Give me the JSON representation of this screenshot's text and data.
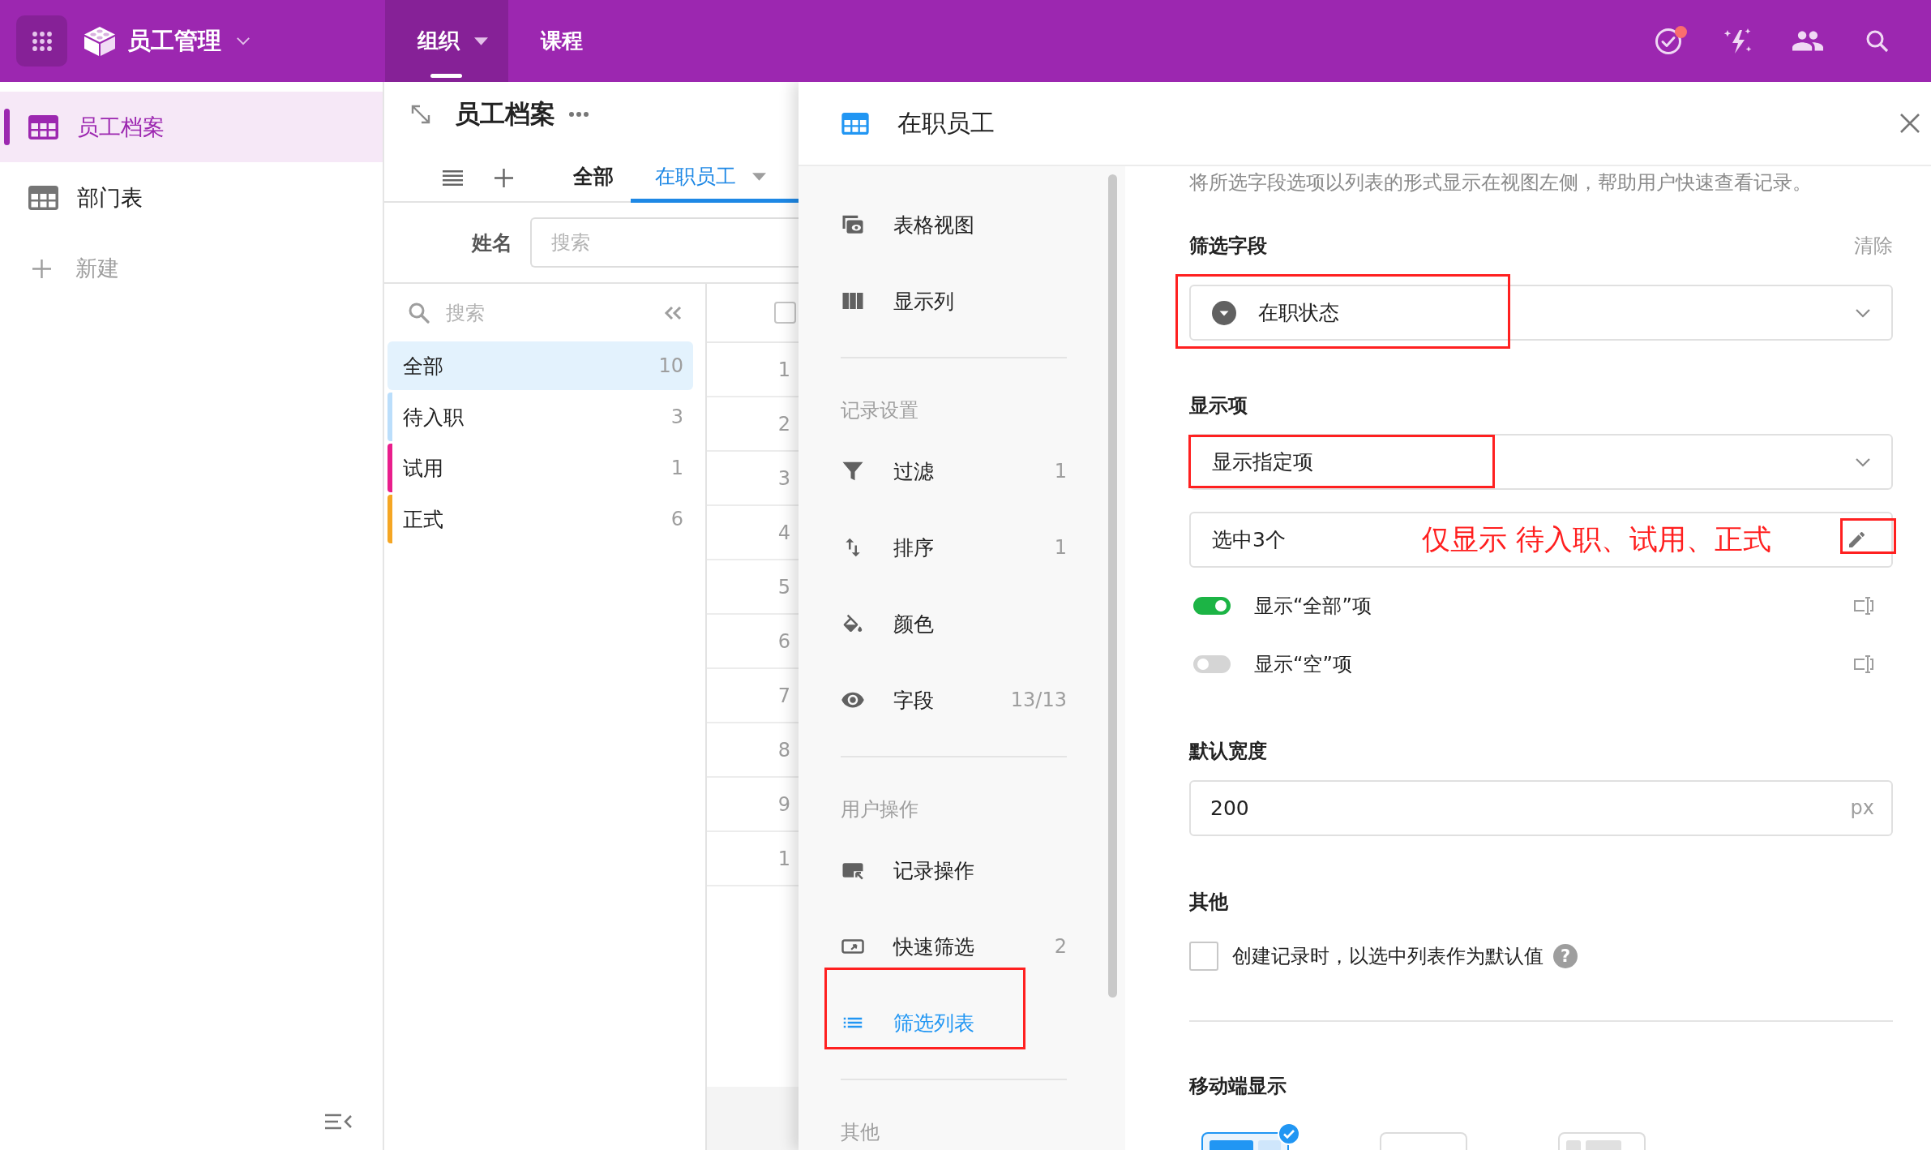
{
  "top_bar": {
    "app_title": "员工管理",
    "tabs": [
      {
        "label": "组织",
        "selected": true,
        "has_menu": true
      },
      {
        "label": "课程",
        "selected": false,
        "has_menu": false
      }
    ],
    "task_notification": true
  },
  "sidebar": {
    "items": [
      {
        "label": "员工档案",
        "selected": true
      },
      {
        "label": "部门表",
        "selected": false
      }
    ],
    "new_item": "新建"
  },
  "table_view": {
    "title": "员工档案",
    "tabs": [
      {
        "label": "全部",
        "selected": false
      },
      {
        "label": "在职员工",
        "selected": true
      }
    ],
    "name_search": {
      "label": "姓名",
      "placeholder": "搜索"
    },
    "filter_list": {
      "search_placeholder": "搜索",
      "items": [
        {
          "label": "全部",
          "count": "10",
          "selected": true
        },
        {
          "label": "待入职",
          "count": "3",
          "selected": false,
          "color": "#bbdefb"
        },
        {
          "label": "试用",
          "count": "1",
          "selected": false,
          "color": "#e91e8c"
        },
        {
          "label": "正式",
          "count": "6",
          "selected": false,
          "color": "#f5a623"
        }
      ]
    },
    "select_all_checked": false,
    "row_numbers": [
      "1",
      "2",
      "3",
      "4",
      "5",
      "6",
      "7",
      "8",
      "9",
      "1"
    ]
  },
  "drawer": {
    "title": "在职员工",
    "nav": [
      {
        "items": [
          {
            "label": "表格视图",
            "selected": false,
            "annotated": false
          },
          {
            "label": "显示列",
            "selected": false,
            "annotated": false
          }
        ]
      },
      {
        "heading": "记录设置",
        "items": [
          {
            "label": "过滤",
            "count": "1",
            "selected": false,
            "annotated": false
          },
          {
            "label": "排序",
            "count": "1",
            "selected": false,
            "annotated": false
          },
          {
            "label": "颜色",
            "selected": false,
            "annotated": false
          },
          {
            "label": "字段",
            "count": "13/13",
            "selected": false,
            "annotated": false
          }
        ]
      },
      {
        "heading": "用户操作",
        "items": [
          {
            "label": "记录操作",
            "selected": false,
            "annotated": false
          },
          {
            "label": "快速筛选",
            "count": "2",
            "selected": false,
            "annotated": false
          },
          {
            "label": "筛选列表",
            "selected": true,
            "annotated": true
          }
        ]
      },
      {
        "heading": "其他"
      }
    ],
    "settings": {
      "description": "将所选字段选项以列表的形式显示在视图左侧，帮助用户快速查看记录。",
      "filter_field": {
        "label": "筛选字段",
        "clear": "清除",
        "value": "在职状态",
        "annotated": true
      },
      "display": {
        "label": "显示项",
        "mode": "显示指定项",
        "mode_annotated": true,
        "selection": "选中3个",
        "note": "仅显示 待入职、试用、正式",
        "edit_annotated": true,
        "toggles": [
          {
            "label": "显示“全部”项",
            "on": true
          },
          {
            "label": "显示“空”项",
            "on": false
          }
        ]
      },
      "default_width": {
        "label": "默认宽度",
        "value": "200",
        "unit": "px"
      },
      "other": {
        "label": "其他",
        "checkbox_label": "创建记录时，以选中列表作为默认值",
        "checked": false,
        "help": "?"
      },
      "mobile_display": {
        "label": "移动端显示",
        "options": [
          {
            "selected": true
          },
          {
            "selected": false
          },
          {
            "selected": false
          }
        ]
      }
    }
  }
}
